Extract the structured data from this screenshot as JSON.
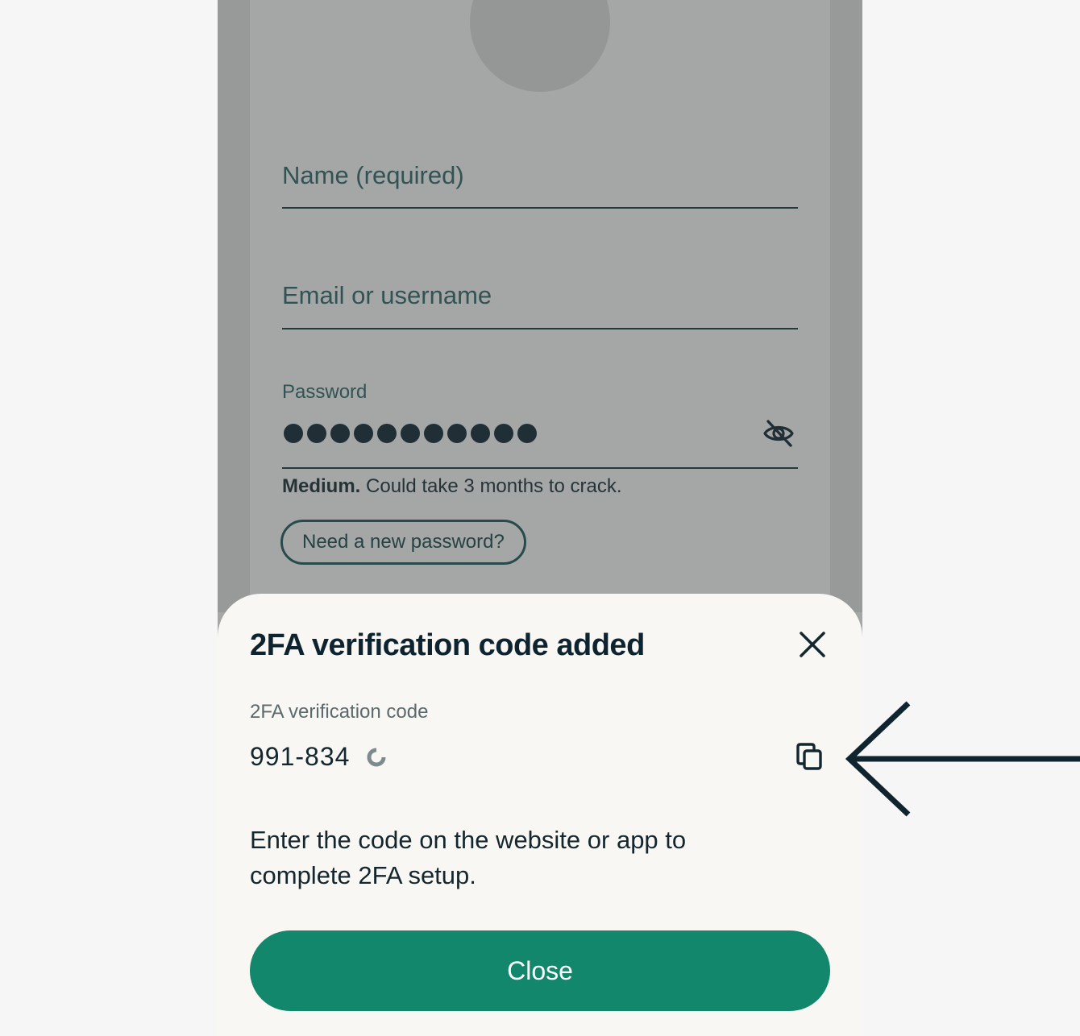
{
  "form": {
    "name_placeholder": "Name (required)",
    "email_placeholder": "Email or username",
    "password_label": "Password",
    "password_dot_count": 11,
    "strength_level": "Medium.",
    "strength_text": "Could take 3 months to crack.",
    "new_password_button": "Need a new password?"
  },
  "sheet": {
    "title": "2FA verification code added",
    "code_label": "2FA verification code",
    "code_value": "991-834",
    "instructions": "Enter the code on the website or app to complete 2FA setup.",
    "close_button": "Close"
  },
  "icons": [
    "eye-slash-icon",
    "close-icon",
    "refresh-timer-icon",
    "copy-icon",
    "arrow-left-icon"
  ],
  "colors": {
    "accent": "#12876c",
    "text_dark": "#14262e",
    "scrim": "#3a3e3e"
  }
}
